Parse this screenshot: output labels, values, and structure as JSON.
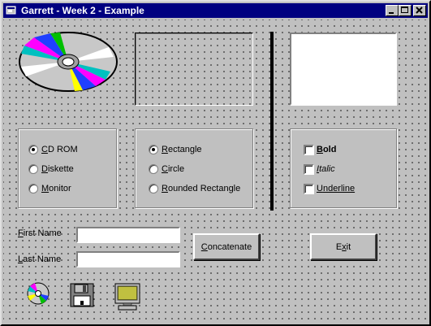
{
  "window": {
    "title": "Garrett - Week 2 - Example",
    "controls": {
      "minimize": "minimize",
      "maximize": "maximize",
      "close": "close"
    }
  },
  "media_group": {
    "options": [
      {
        "ul": "C",
        "rest": "D ROM",
        "selected": true
      },
      {
        "ul": "D",
        "rest": "iskette",
        "selected": false
      },
      {
        "ul": "M",
        "rest": "onitor",
        "selected": false
      }
    ]
  },
  "shape_group": {
    "options": [
      {
        "ul": "R",
        "rest": "ectangle",
        "selected": true
      },
      {
        "ul": "C",
        "rest": "ircle",
        "selected": false
      },
      {
        "ul": "R",
        "rest": "ounded Rectangle",
        "selected": false
      }
    ]
  },
  "style_group": {
    "options": [
      {
        "ul": "B",
        "rest": "old",
        "checked": false
      },
      {
        "ul": "I",
        "rest": "talic",
        "checked": false
      },
      {
        "ul": "U",
        "rest": "nderline",
        "checked": false
      }
    ]
  },
  "form": {
    "first_name": {
      "ul": "F",
      "rest": "irst Name",
      "value": ""
    },
    "last_name": {
      "ul": "L",
      "rest": "ast Name",
      "value": ""
    },
    "concatenate": {
      "ul": "C",
      "rest": "oncatenate"
    },
    "exit": {
      "pre": "E",
      "ul": "x",
      "rest": "it"
    }
  },
  "icons": [
    "cd-icon",
    "floppy-disk-icon",
    "monitor-icon"
  ],
  "colors": {
    "title_bar": "#000080",
    "face": "#c0c0c0",
    "shadow": "#808080",
    "highlight": "#ffffff"
  }
}
